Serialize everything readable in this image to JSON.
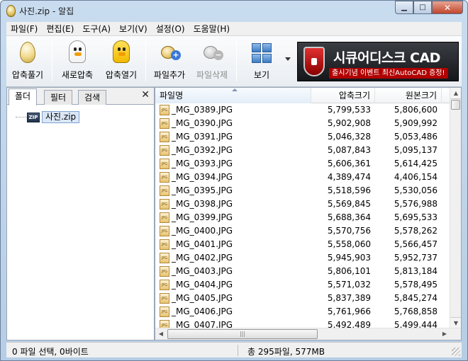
{
  "window": {
    "title": "사진.zip - 알집"
  },
  "menu": [
    "파일(F)",
    "편집(E)",
    "도구(A)",
    "보기(V)",
    "설정(O)",
    "도움말(H)"
  ],
  "toolbar": {
    "buttons": [
      {
        "label": "압축풀기",
        "icon": "egg-icon"
      },
      {
        "label": "새로압축",
        "icon": "chick-icon"
      },
      {
        "label": "압축열기",
        "icon": "yellow-chick-icon"
      },
      {
        "label": "파일추가",
        "icon": "add-file-icon"
      },
      {
        "label": "파일삭제",
        "icon": "delete-file-icon",
        "disabled": true
      },
      {
        "label": "보기",
        "icon": "view-grid-icon"
      }
    ],
    "ad": {
      "title": "시큐어디스크 CAD",
      "subtitle": "출시기념 이벤트 최신AutoCAD 증정!"
    }
  },
  "left_panel": {
    "tabs": [
      "폴더",
      "필터",
      "검색"
    ],
    "active_tab": "폴더",
    "tree": {
      "label": "사진.zip",
      "icon_text": "ZIP"
    }
  },
  "file_list": {
    "columns": {
      "name": "파일명",
      "compressed": "압축크기",
      "original": "원본크기"
    },
    "file_icon_text": "JPG",
    "rows": [
      {
        "name": "_MG_0389.JPG",
        "compressed": "5,799,533",
        "original": "5,806,600"
      },
      {
        "name": "_MG_0390.JPG",
        "compressed": "5,902,908",
        "original": "5,909,992"
      },
      {
        "name": "_MG_0391.JPG",
        "compressed": "5,046,328",
        "original": "5,053,486"
      },
      {
        "name": "_MG_0392.JPG",
        "compressed": "5,087,843",
        "original": "5,095,137"
      },
      {
        "name": "_MG_0393.JPG",
        "compressed": "5,606,361",
        "original": "5,614,425"
      },
      {
        "name": "_MG_0394.JPG",
        "compressed": "4,389,474",
        "original": "4,406,154"
      },
      {
        "name": "_MG_0395.JPG",
        "compressed": "5,518,596",
        "original": "5,530,056"
      },
      {
        "name": "_MG_0398.JPG",
        "compressed": "5,569,845",
        "original": "5,576,988"
      },
      {
        "name": "_MG_0399.JPG",
        "compressed": "5,688,364",
        "original": "5,695,533"
      },
      {
        "name": "_MG_0400.JPG",
        "compressed": "5,570,756",
        "original": "5,578,262"
      },
      {
        "name": "_MG_0401.JPG",
        "compressed": "5,558,060",
        "original": "5,566,457"
      },
      {
        "name": "_MG_0402.JPG",
        "compressed": "5,945,903",
        "original": "5,952,737"
      },
      {
        "name": "_MG_0403.JPG",
        "compressed": "5,806,101",
        "original": "5,813,184"
      },
      {
        "name": "_MG_0404.JPG",
        "compressed": "5,571,032",
        "original": "5,578,495"
      },
      {
        "name": "_MG_0405.JPG",
        "compressed": "5,837,389",
        "original": "5,845,274"
      },
      {
        "name": "_MG_0406.JPG",
        "compressed": "5,761,966",
        "original": "5,768,858"
      },
      {
        "name": "_MG_0407.JPG",
        "compressed": "5,492,489",
        "original": "5,499,444"
      }
    ]
  },
  "status": {
    "left": "0 파일 선택,  0바이트",
    "right": "총 295파일,  577MB"
  }
}
